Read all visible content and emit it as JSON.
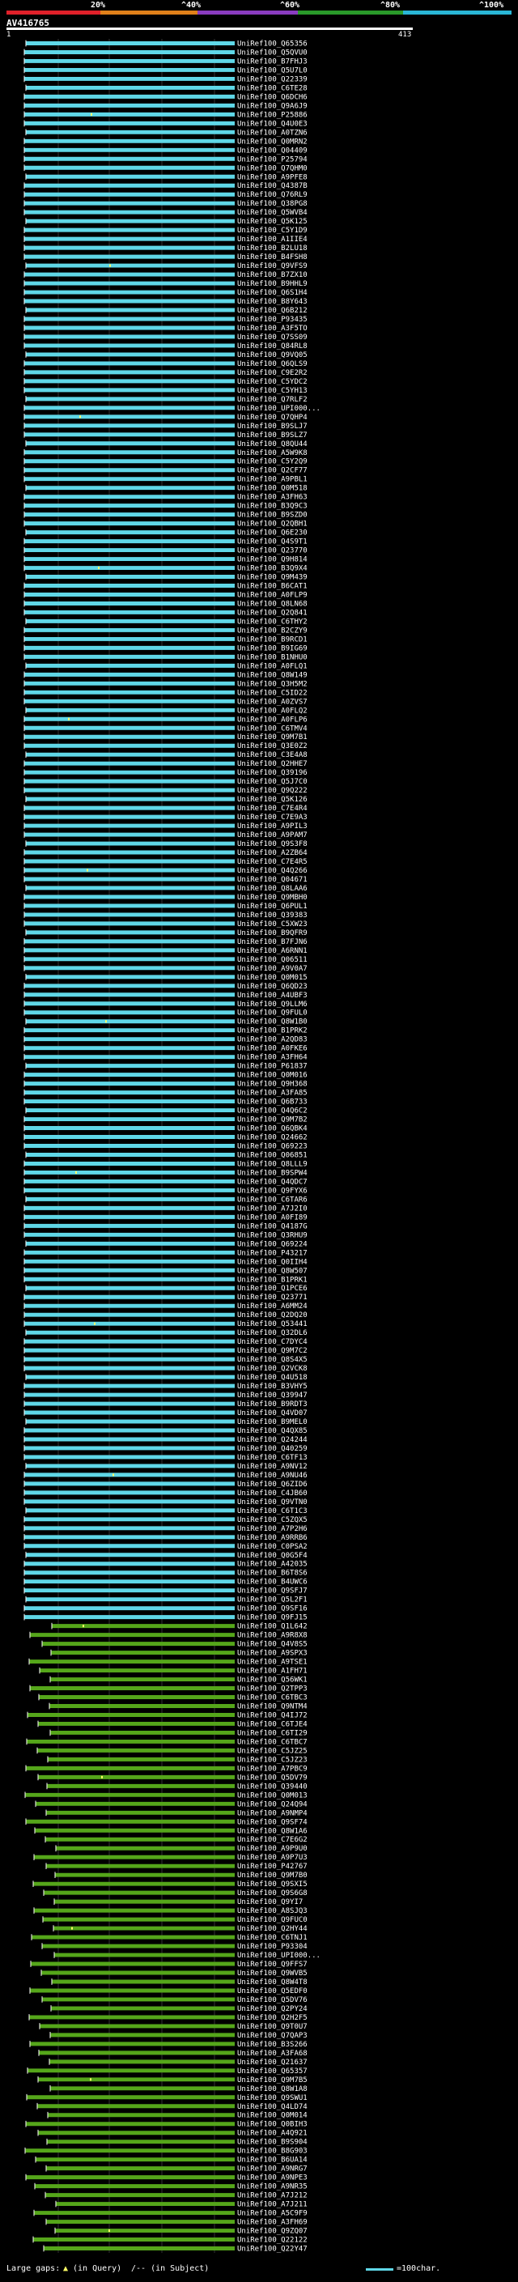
{
  "query": {
    "name": "AV416765",
    "start": "1",
    "end": "413"
  },
  "identity_scale": [
    {
      "label": "20%",
      "color": "#e0202a"
    },
    {
      "label": "^40%",
      "color": "#e0801a"
    },
    {
      "label": "^60%",
      "color": "#8a3cc0"
    },
    {
      "label": "^80%",
      "color": "#2a9a2a"
    },
    {
      "label": "^100%",
      "color": "#2ab6d6"
    }
  ],
  "colors": {
    "high": "#5fd7e7",
    "mid": "#55a61a",
    "dot": "#ffff66",
    "gap": "#ffffff"
  },
  "hits": [
    {
      "id": "UniRef100_Q65356",
      "identity": "high"
    },
    {
      "id": "UniRef100_Q5QVU0",
      "identity": "high"
    },
    {
      "id": "UniRef100_B7FHJ3",
      "identity": "high"
    },
    {
      "id": "UniRef100_Q5U7L0",
      "identity": "high"
    },
    {
      "id": "UniRef100_Q22339",
      "identity": "high"
    },
    {
      "id": "UniRef100_C6TE28",
      "identity": "high"
    },
    {
      "id": "UniRef100_Q6DCH6",
      "identity": "high"
    },
    {
      "id": "UniRef100_Q9A6J9",
      "identity": "high"
    },
    {
      "id": "UniRef100_P25886",
      "identity": "high"
    },
    {
      "id": "UniRef100_Q4U0E3",
      "identity": "high"
    },
    {
      "id": "UniRef100_A0TZN6",
      "identity": "high"
    },
    {
      "id": "UniRef100_Q0MRN2",
      "identity": "high"
    },
    {
      "id": "UniRef100_Q04409",
      "identity": "high"
    },
    {
      "id": "UniRef100_P25794",
      "identity": "high"
    },
    {
      "id": "UniRef100_Q7QHM0",
      "identity": "high"
    },
    {
      "id": "UniRef100_A9PFE8",
      "identity": "high"
    },
    {
      "id": "UniRef100_Q4387B",
      "identity": "high"
    },
    {
      "id": "UniRef100_Q76RL9",
      "identity": "high"
    },
    {
      "id": "UniRef100_Q38PG8",
      "identity": "high"
    },
    {
      "id": "UniRef100_Q5WVB4",
      "identity": "high"
    },
    {
      "id": "UniRef100_Q5K125",
      "identity": "high"
    },
    {
      "id": "UniRef100_C5Y1D9",
      "identity": "high"
    },
    {
      "id": "UniRef100_A1IIE4",
      "identity": "high"
    },
    {
      "id": "UniRef100_B2LU18",
      "identity": "high"
    },
    {
      "id": "UniRef100_B4FSH8",
      "identity": "high"
    },
    {
      "id": "UniRef100_Q9VFS9",
      "identity": "high"
    },
    {
      "id": "UniRef100_B7ZX10",
      "identity": "high"
    },
    {
      "id": "UniRef100_B9HHL9",
      "identity": "high"
    },
    {
      "id": "UniRef100_Q6S1H4",
      "identity": "high"
    },
    {
      "id": "UniRef100_B8Y643",
      "identity": "high"
    },
    {
      "id": "UniRef100_Q6B212",
      "identity": "high"
    },
    {
      "id": "UniRef100_P93435",
      "identity": "high"
    },
    {
      "id": "UniRef100_A3F5TO",
      "identity": "high"
    },
    {
      "id": "UniRef100_Q7SS09",
      "identity": "high"
    },
    {
      "id": "UniRef100_Q84RL8",
      "identity": "high"
    },
    {
      "id": "UniRef100_Q9VQ05",
      "identity": "high"
    },
    {
      "id": "UniRef100_Q6QLS9",
      "identity": "high"
    },
    {
      "id": "UniRef100_C9E2R2",
      "identity": "high"
    },
    {
      "id": "UniRef100_C5YDC2",
      "identity": "high"
    },
    {
      "id": "UniRef100_C5YH13",
      "identity": "high"
    },
    {
      "id": "UniRef100_Q7RLF2",
      "identity": "high"
    },
    {
      "id": "UniRef100_UPI000...",
      "identity": "high"
    },
    {
      "id": "UniRef100_Q7QHP4",
      "identity": "high"
    },
    {
      "id": "UniRef100_B9SLJ7",
      "identity": "high"
    },
    {
      "id": "UniRef100_B9SLZ7",
      "identity": "high"
    },
    {
      "id": "UniRef100_Q8QU44",
      "identity": "high"
    },
    {
      "id": "UniRef100_A5W9K8",
      "identity": "high"
    },
    {
      "id": "UniRef100_C5Y2Q9",
      "identity": "high"
    },
    {
      "id": "UniRef100_Q2CF77",
      "identity": "high"
    },
    {
      "id": "UniRef100_A9PBL1",
      "identity": "high"
    },
    {
      "id": "UniRef100_Q0M518",
      "identity": "high"
    },
    {
      "id": "UniRef100_A3FH63",
      "identity": "high"
    },
    {
      "id": "UniRef100_B3Q9C3",
      "identity": "high"
    },
    {
      "id": "UniRef100_B9SZD0",
      "identity": "high"
    },
    {
      "id": "UniRef100_Q2QBH1",
      "identity": "high"
    },
    {
      "id": "UniRef100_Q6E230",
      "identity": "high"
    },
    {
      "id": "UniRef100_Q4S9T1",
      "identity": "high"
    },
    {
      "id": "UniRef100_Q23770",
      "identity": "high"
    },
    {
      "id": "UniRef100_Q9H814",
      "identity": "high"
    },
    {
      "id": "UniRef100_B3Q9X4",
      "identity": "high"
    },
    {
      "id": "UniRef100_Q9M439",
      "identity": "high"
    },
    {
      "id": "UniRef100_B6CAT1",
      "identity": "high"
    },
    {
      "id": "UniRef100_A0FLP9",
      "identity": "high"
    },
    {
      "id": "UniRef100_Q8LN68",
      "identity": "high"
    },
    {
      "id": "UniRef100_Q2Q841",
      "identity": "high"
    },
    {
      "id": "UniRef100_C6THY2",
      "identity": "high"
    },
    {
      "id": "UniRef100_B2CZY9",
      "identity": "high"
    },
    {
      "id": "UniRef100_B9RCD1",
      "identity": "high"
    },
    {
      "id": "UniRef100_B9IG69",
      "identity": "high"
    },
    {
      "id": "UniRef100_B1NHU0",
      "identity": "high"
    },
    {
      "id": "UniRef100_A0FLQ1",
      "identity": "high"
    },
    {
      "id": "UniRef100_Q8W149",
      "identity": "high"
    },
    {
      "id": "UniRef100_Q3H5M2",
      "identity": "high"
    },
    {
      "id": "UniRef100_C5ID22",
      "identity": "high"
    },
    {
      "id": "UniRef100_A0ZVS7",
      "identity": "high"
    },
    {
      "id": "UniRef100_A0FLQ2",
      "identity": "high"
    },
    {
      "id": "UniRef100_A0FLP6",
      "identity": "high"
    },
    {
      "id": "UniRef100_C6TMV4",
      "identity": "high"
    },
    {
      "id": "UniRef100_Q9M7B1",
      "identity": "high"
    },
    {
      "id": "UniRef100_Q3E0Z2",
      "identity": "high"
    },
    {
      "id": "UniRef100_C3E4A8",
      "identity": "high"
    },
    {
      "id": "UniRef100_Q2HHE7",
      "identity": "high"
    },
    {
      "id": "UniRef100_Q39196",
      "identity": "high"
    },
    {
      "id": "UniRef100_Q5J7C0",
      "identity": "high"
    },
    {
      "id": "UniRef100_Q9Q222",
      "identity": "high"
    },
    {
      "id": "UniRef100_Q5K126",
      "identity": "high"
    },
    {
      "id": "UniRef100_C7E4R4",
      "identity": "high"
    },
    {
      "id": "UniRef100_C7E9A3",
      "identity": "high"
    },
    {
      "id": "UniRef100_A9PIL3",
      "identity": "high"
    },
    {
      "id": "UniRef100_A9PAM7",
      "identity": "high"
    },
    {
      "id": "UniRef100_Q9S3F8",
      "identity": "high"
    },
    {
      "id": "UniRef100_A2ZB64",
      "identity": "high"
    },
    {
      "id": "UniRef100_C7E4R5",
      "identity": "high"
    },
    {
      "id": "UniRef100_Q4Q266",
      "identity": "high"
    },
    {
      "id": "UniRef100_Q04671",
      "identity": "high"
    },
    {
      "id": "UniRef100_Q8LAA6",
      "identity": "high"
    },
    {
      "id": "UniRef100_Q9MBH0",
      "identity": "high"
    },
    {
      "id": "UniRef100_Q6PUL1",
      "identity": "high"
    },
    {
      "id": "UniRef100_Q39383",
      "identity": "high"
    },
    {
      "id": "UniRef100_C5XW23",
      "identity": "high"
    },
    {
      "id": "UniRef100_B9QFR9",
      "identity": "high"
    },
    {
      "id": "UniRef100_B7FJN6",
      "identity": "high"
    },
    {
      "id": "UniRef100_A6RNN1",
      "identity": "high"
    },
    {
      "id": "UniRef100_Q06511",
      "identity": "high"
    },
    {
      "id": "UniRef100_A9V0A7",
      "identity": "high"
    },
    {
      "id": "UniRef100_Q0M015",
      "identity": "high"
    },
    {
      "id": "UniRef100_Q6QD23",
      "identity": "high"
    },
    {
      "id": "UniRef100_A4UBF3",
      "identity": "high"
    },
    {
      "id": "UniRef100_Q9LLM6",
      "identity": "high"
    },
    {
      "id": "UniRef100_Q9FUL0",
      "identity": "high"
    },
    {
      "id": "UniRef100_Q8W1B0",
      "identity": "high"
    },
    {
      "id": "UniRef100_B1PRK2",
      "identity": "high"
    },
    {
      "id": "UniRef100_A2QD83",
      "identity": "high"
    },
    {
      "id": "UniRef100_A0FKE6",
      "identity": "high"
    },
    {
      "id": "UniRef100_A3FH64",
      "identity": "high"
    },
    {
      "id": "UniRef100_P61837",
      "identity": "high"
    },
    {
      "id": "UniRef100_Q0M016",
      "identity": "high"
    },
    {
      "id": "UniRef100_Q9H368",
      "identity": "high"
    },
    {
      "id": "UniRef100_A3FA85",
      "identity": "high"
    },
    {
      "id": "UniRef100_Q6B733",
      "identity": "high"
    },
    {
      "id": "UniRef100_Q4Q6C2",
      "identity": "high"
    },
    {
      "id": "UniRef100_Q9M7B2",
      "identity": "high"
    },
    {
      "id": "UniRef100_Q6QBK4",
      "identity": "high"
    },
    {
      "id": "UniRef100_Q24662",
      "identity": "high"
    },
    {
      "id": "UniRef100_Q69223",
      "identity": "high"
    },
    {
      "id": "UniRef100_Q06851",
      "identity": "high"
    },
    {
      "id": "UniRef100_Q8LLL9",
      "identity": "high"
    },
    {
      "id": "UniRef100_B9SPW4",
      "identity": "high"
    },
    {
      "id": "UniRef100_Q4QDC7",
      "identity": "high"
    },
    {
      "id": "UniRef100_Q9FYX6",
      "identity": "high"
    },
    {
      "id": "UniRef100_C6TAR6",
      "identity": "high"
    },
    {
      "id": "UniRef100_A7J2I0",
      "identity": "high"
    },
    {
      "id": "UniRef100_A0FI89",
      "identity": "high"
    },
    {
      "id": "UniRef100_Q4187G",
      "identity": "high"
    },
    {
      "id": "UniRef100_Q3RHU9",
      "identity": "high"
    },
    {
      "id": "UniRef100_Q69224",
      "identity": "high"
    },
    {
      "id": "UniRef100_P43217",
      "identity": "high"
    },
    {
      "id": "UniRef100_Q0IIH4",
      "identity": "high"
    },
    {
      "id": "UniRef100_Q8W507",
      "identity": "high"
    },
    {
      "id": "UniRef100_B1PRK1",
      "identity": "high"
    },
    {
      "id": "UniRef100_Q1PCE6",
      "identity": "high"
    },
    {
      "id": "UniRef100_Q23771",
      "identity": "high"
    },
    {
      "id": "UniRef100_A6MM24",
      "identity": "high"
    },
    {
      "id": "UniRef100_Q2DQ20",
      "identity": "high"
    },
    {
      "id": "UniRef100_Q53441",
      "identity": "high"
    },
    {
      "id": "UniRef100_Q32DL6",
      "identity": "high"
    },
    {
      "id": "UniRef100_C7DYC4",
      "identity": "high"
    },
    {
      "id": "UniRef100_Q9M7C2",
      "identity": "high"
    },
    {
      "id": "UniRef100_Q8S4X5",
      "identity": "high"
    },
    {
      "id": "UniRef100_Q2VCK8",
      "identity": "high"
    },
    {
      "id": "UniRef100_Q4U518",
      "identity": "high"
    },
    {
      "id": "UniRef100_B3VHY5",
      "identity": "high"
    },
    {
      "id": "UniRef100_Q39947",
      "identity": "high"
    },
    {
      "id": "UniRef100_B9RDT3",
      "identity": "high"
    },
    {
      "id": "UniRef100_Q4VD07",
      "identity": "high"
    },
    {
      "id": "UniRef100_B9MEL0",
      "identity": "high"
    },
    {
      "id": "UniRef100_Q4QX85",
      "identity": "high"
    },
    {
      "id": "UniRef100_Q24244",
      "identity": "high"
    },
    {
      "id": "UniRef100_Q40259",
      "identity": "high"
    },
    {
      "id": "UniRef100_C6TF13",
      "identity": "high"
    },
    {
      "id": "UniRef100_A9NV12",
      "identity": "high"
    },
    {
      "id": "UniRef100_A9NU46",
      "identity": "high"
    },
    {
      "id": "UniRef100_Q6ZID6",
      "identity": "high"
    },
    {
      "id": "UniRef100_C4JB60",
      "identity": "high"
    },
    {
      "id": "UniRef100_Q9VTN0",
      "identity": "high"
    },
    {
      "id": "UniRef100_C6T1C3",
      "identity": "high"
    },
    {
      "id": "UniRef100_C5ZQX5",
      "identity": "high"
    },
    {
      "id": "UniRef100_A7P2H6",
      "identity": "high"
    },
    {
      "id": "UniRef100_A9RRB6",
      "identity": "high"
    },
    {
      "id": "UniRef100_C0PSA2",
      "identity": "high"
    },
    {
      "id": "UniRef100_Q0G5F4",
      "identity": "high"
    },
    {
      "id": "UniRef100_A42035",
      "identity": "high"
    },
    {
      "id": "UniRef100_B6T8S6",
      "identity": "high"
    },
    {
      "id": "UniRef100_B4UWC6",
      "identity": "high"
    },
    {
      "id": "UniRef100_Q9SFJ7",
      "identity": "high"
    },
    {
      "id": "UniRef100_Q5L2F1",
      "identity": "high"
    },
    {
      "id": "UniRef100_Q9SF16",
      "identity": "high"
    },
    {
      "id": "UniRef100_Q9FJ15",
      "identity": "high"
    },
    {
      "id": "UniRef100_Q1L642",
      "identity": "mid"
    },
    {
      "id": "UniRef100_A9R8X8",
      "identity": "mid"
    },
    {
      "id": "UniRef100_Q4V8S5",
      "identity": "mid"
    },
    {
      "id": "UniRef100_A9SPX3",
      "identity": "mid"
    },
    {
      "id": "UniRef100_A9TSE1",
      "identity": "mid"
    },
    {
      "id": "UniRef100_A1FH71",
      "identity": "mid"
    },
    {
      "id": "UniRef100_Q56WK1",
      "identity": "mid"
    },
    {
      "id": "UniRef100_Q2TPP3",
      "identity": "mid"
    },
    {
      "id": "UniRef100_C6TBC3",
      "identity": "mid"
    },
    {
      "id": "UniRef100_Q9NTM4",
      "identity": "mid"
    },
    {
      "id": "UniRef100_Q4IJ72",
      "identity": "mid"
    },
    {
      "id": "UniRef100_C6TJE4",
      "identity": "mid"
    },
    {
      "id": "UniRef100_C6TI29",
      "identity": "mid"
    },
    {
      "id": "UniRef100_C6TBC7",
      "identity": "mid"
    },
    {
      "id": "UniRef100_C5JZ25",
      "identity": "mid"
    },
    {
      "id": "UniRef100_C5JZ23",
      "identity": "mid"
    },
    {
      "id": "UniRef100_A7PBC9",
      "identity": "mid"
    },
    {
      "id": "UniRef100_Q5DV79",
      "identity": "mid"
    },
    {
      "id": "UniRef100_Q39440",
      "identity": "mid"
    },
    {
      "id": "UniRef100_Q0M013",
      "identity": "mid"
    },
    {
      "id": "UniRef100_Q24Q94",
      "identity": "mid"
    },
    {
      "id": "UniRef100_A9NMP4",
      "identity": "mid"
    },
    {
      "id": "UniRef100_Q9SF74",
      "identity": "mid"
    },
    {
      "id": "UniRef100_Q8W1A6",
      "identity": "mid"
    },
    {
      "id": "UniRef100_C7E6G2",
      "identity": "mid"
    },
    {
      "id": "UniRef100_A9P9U0",
      "identity": "mid"
    },
    {
      "id": "UniRef100_A9P7U3",
      "identity": "mid"
    },
    {
      "id": "UniRef100_P42767",
      "identity": "mid"
    },
    {
      "id": "UniRef100_Q9M7B0",
      "identity": "mid"
    },
    {
      "id": "UniRef100_Q9SXI5",
      "identity": "mid"
    },
    {
      "id": "UniRef100_Q9S6G8",
      "identity": "mid"
    },
    {
      "id": "UniRef100_Q9YI7",
      "identity": "mid"
    },
    {
      "id": "UniRef100_A8SJQ3",
      "identity": "mid"
    },
    {
      "id": "UniRef100_Q9FUC0",
      "identity": "mid"
    },
    {
      "id": "UniRef100_Q2HY44",
      "identity": "mid"
    },
    {
      "id": "UniRef100_C6TNJ1",
      "identity": "mid"
    },
    {
      "id": "UniRef100_P93304",
      "identity": "mid"
    },
    {
      "id": "UniRef100_UPI000...",
      "identity": "mid"
    },
    {
      "id": "UniRef100_Q9FFS7",
      "identity": "mid"
    },
    {
      "id": "UniRef100_Q9WVB5",
      "identity": "mid"
    },
    {
      "id": "UniRef100_Q8W4T8",
      "identity": "mid"
    },
    {
      "id": "UniRef100_Q5EDF0",
      "identity": "mid"
    },
    {
      "id": "UniRef100_Q5DV76",
      "identity": "mid"
    },
    {
      "id": "UniRef100_Q2PY24",
      "identity": "mid"
    },
    {
      "id": "UniRef100_Q2H2F5",
      "identity": "mid"
    },
    {
      "id": "UniRef100_Q9T0U7",
      "identity": "mid"
    },
    {
      "id": "UniRef100_Q7QAP3",
      "identity": "mid"
    },
    {
      "id": "UniRef100_B3S266",
      "identity": "mid"
    },
    {
      "id": "UniRef100_A3FA68",
      "identity": "mid"
    },
    {
      "id": "UniRef100_Q21637",
      "identity": "mid"
    },
    {
      "id": "UniRef100_Q65357",
      "identity": "mid"
    },
    {
      "id": "UniRef100_Q9M7B5",
      "identity": "mid"
    },
    {
      "id": "UniRef100_Q8W1A8",
      "identity": "mid"
    },
    {
      "id": "UniRef100_Q9SWU1",
      "identity": "mid"
    },
    {
      "id": "UniRef100_Q4LD74",
      "identity": "mid"
    },
    {
      "id": "UniRef100_Q0M014",
      "identity": "mid"
    },
    {
      "id": "UniRef100_Q0BIH3",
      "identity": "mid"
    },
    {
      "id": "UniRef100_A4Q921",
      "identity": "mid"
    },
    {
      "id": "UniRef100_B9S904",
      "identity": "mid"
    },
    {
      "id": "UniRef100_B8G903",
      "identity": "mid"
    },
    {
      "id": "UniRef100_B6UA14",
      "identity": "mid"
    },
    {
      "id": "UniRef100_A9NRG7",
      "identity": "mid"
    },
    {
      "id": "UniRef100_A9NPE3",
      "identity": "mid"
    },
    {
      "id": "UniRef100_A9NR35",
      "identity": "mid"
    },
    {
      "id": "UniRef100_A7J212",
      "identity": "mid"
    },
    {
      "id": "UniRef100_A7J211",
      "identity": "mid"
    },
    {
      "id": "UniRef100_A5C9F9",
      "identity": "mid"
    },
    {
      "id": "UniRef100_A3FH69",
      "identity": "mid"
    },
    {
      "id": "UniRef100_Q9ZQ07",
      "identity": "mid"
    },
    {
      "id": "UniRef100_Q22122",
      "identity": "mid"
    },
    {
      "id": "UniRef100_Q22Y47",
      "identity": "mid"
    }
  ],
  "footer": {
    "gaps_label": "Large gaps:",
    "query_gap": "(in Query)",
    "subject_gap": "/-- (in Subject)",
    "scale_label": "=100char."
  }
}
